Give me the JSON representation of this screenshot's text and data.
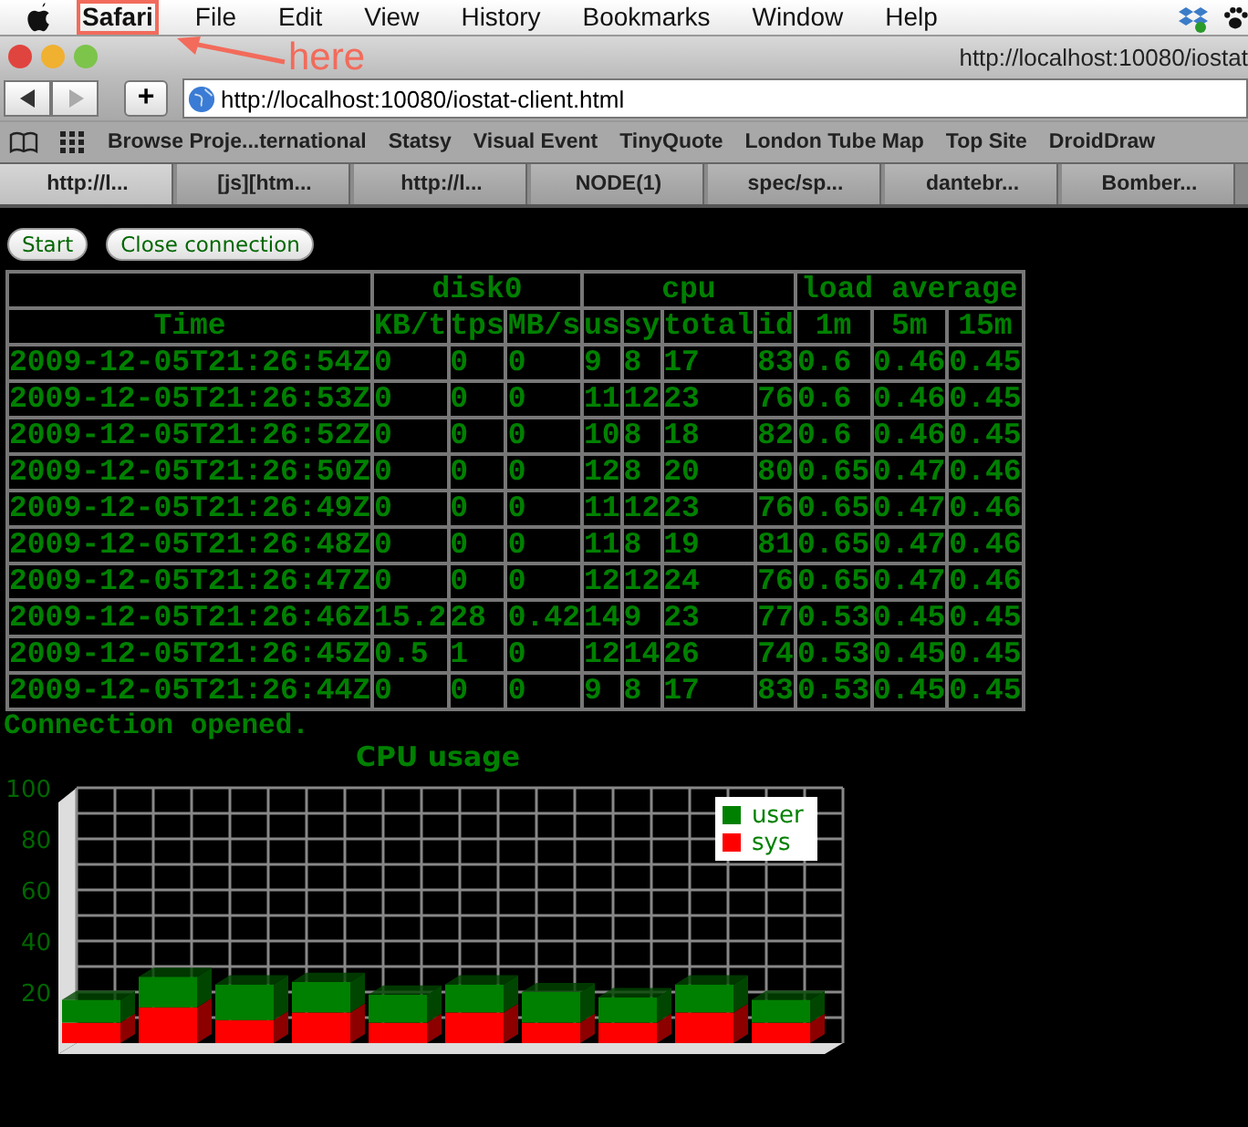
{
  "menu_bar": {
    "items": [
      {
        "label": "Safari",
        "boxed": true
      },
      {
        "label": "File",
        "boxed": false
      },
      {
        "label": "Edit",
        "boxed": false
      },
      {
        "label": "View",
        "boxed": false
      },
      {
        "label": "History",
        "boxed": false
      },
      {
        "label": "Bookmarks",
        "boxed": false
      },
      {
        "label": "Window",
        "boxed": false
      },
      {
        "label": "Help",
        "boxed": false
      }
    ]
  },
  "annotation": {
    "text": "here"
  },
  "window": {
    "title": "http://localhost:10080/iostat"
  },
  "toolbar": {
    "add_button": "+",
    "url": "http://localhost:10080/iostat-client.html"
  },
  "bookmarks": [
    "Browse Proje...ternational",
    "Statsy",
    "Visual Event",
    "TinyQuote",
    "London Tube Map",
    "Top Site",
    "DroidDraw"
  ],
  "tabs": [
    {
      "label": "http://l...",
      "selected": true
    },
    {
      "label": "[js][htm...",
      "selected": false
    },
    {
      "label": "http://l...",
      "selected": false
    },
    {
      "label": "NODE(1)",
      "selected": false
    },
    {
      "label": "spec/sp...",
      "selected": false
    },
    {
      "label": "dantebr...",
      "selected": false
    },
    {
      "label": "Bomber...",
      "selected": false
    }
  ],
  "buttons": [
    "Start",
    "Close connection"
  ],
  "table": {
    "groups": [
      "disk0",
      "cpu",
      "load average"
    ],
    "columns": [
      "Time",
      "KB/t",
      "tps",
      "MB/s",
      "us",
      "sy",
      "total",
      "id",
      "1m",
      "5m",
      "15m"
    ],
    "rows": [
      [
        "2009-12-05T21:26:54Z",
        "0",
        "0",
        "0",
        "9",
        "8",
        "17",
        "83",
        "0.6",
        "0.46",
        "0.45"
      ],
      [
        "2009-12-05T21:26:53Z",
        "0",
        "0",
        "0",
        "11",
        "12",
        "23",
        "76",
        "0.6",
        "0.46",
        "0.45"
      ],
      [
        "2009-12-05T21:26:52Z",
        "0",
        "0",
        "0",
        "10",
        "8",
        "18",
        "82",
        "0.6",
        "0.46",
        "0.45"
      ],
      [
        "2009-12-05T21:26:50Z",
        "0",
        "0",
        "0",
        "12",
        "8",
        "20",
        "80",
        "0.65",
        "0.47",
        "0.46"
      ],
      [
        "2009-12-05T21:26:49Z",
        "0",
        "0",
        "0",
        "11",
        "12",
        "23",
        "76",
        "0.65",
        "0.47",
        "0.46"
      ],
      [
        "2009-12-05T21:26:48Z",
        "0",
        "0",
        "0",
        "11",
        "8",
        "19",
        "81",
        "0.65",
        "0.47",
        "0.46"
      ],
      [
        "2009-12-05T21:26:47Z",
        "0",
        "0",
        "0",
        "12",
        "12",
        "24",
        "76",
        "0.65",
        "0.47",
        "0.46"
      ],
      [
        "2009-12-05T21:26:46Z",
        "15.2",
        "28",
        "0.42",
        "14",
        "9",
        "23",
        "77",
        "0.53",
        "0.45",
        "0.45"
      ],
      [
        "2009-12-05T21:26:45Z",
        "0.5",
        "1",
        "0",
        "12",
        "14",
        "26",
        "74",
        "0.53",
        "0.45",
        "0.45"
      ],
      [
        "2009-12-05T21:26:44Z",
        "0",
        "0",
        "0",
        "9",
        "8",
        "17",
        "83",
        "0.53",
        "0.45",
        "0.45"
      ]
    ]
  },
  "status": "Connection opened.",
  "chart": {
    "chart_data": {
      "type": "bar",
      "title": "CPU usage",
      "stacked": true,
      "grid": true,
      "legend": true,
      "ylim": [
        0,
        100
      ],
      "yticks": [
        20,
        40,
        60,
        80,
        100
      ],
      "series": [
        {
          "name": "sys",
          "color": "#ff0000",
          "values": [
            8,
            14,
            9,
            12,
            8,
            12,
            8,
            8,
            12,
            8
          ]
        },
        {
          "name": "user",
          "color": "#008000",
          "values": [
            9,
            12,
            14,
            12,
            11,
            11,
            12,
            10,
            11,
            9
          ]
        }
      ]
    }
  }
}
